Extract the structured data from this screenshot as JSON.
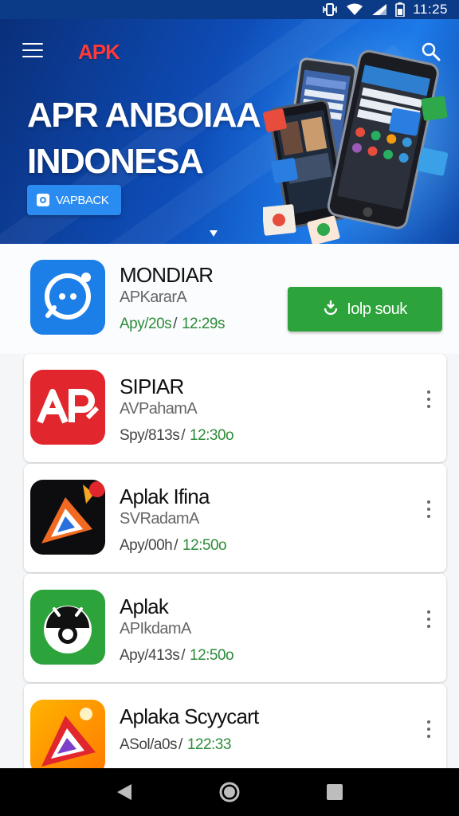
{
  "status_bar": {
    "time": "11:25"
  },
  "header": {
    "logo": "APK",
    "title_line1": "APR ANBOIAA",
    "title_line2": "INDONESA",
    "button_label": "VAPBACK"
  },
  "apps": [
    {
      "name": "MONDIAR",
      "subtitle": "APKararA",
      "meta_left": "Apy/20s",
      "meta_right": "12:29s",
      "icon": "chat-bubble-icon",
      "action_label": "Iolp souk"
    },
    {
      "name": "SIPIAR",
      "subtitle": "AVPahamA",
      "meta_left": "Spy/813s",
      "meta_right": "12:30o",
      "icon": "ap-logo-icon"
    },
    {
      "name": "Aplak Ifina",
      "subtitle": "SVRadamA",
      "meta_left": "Apy/00h",
      "meta_right": "12:50o",
      "icon": "fox-play-icon"
    },
    {
      "name": "Aplak",
      "subtitle": "APIkdamA",
      "meta_left": "Apy/413s",
      "meta_right": "12:50o",
      "icon": "android-robot-icon"
    },
    {
      "name": "Aplaka Scyycart",
      "subtitle": "ASol/a0s",
      "meta_left": "",
      "meta_right": "122:33",
      "icon": "play-triangle-icon"
    }
  ],
  "colors": {
    "accent_green": "#2da33b",
    "banner_blue": "#0e4db8",
    "logo_red": "#ff3a3a"
  }
}
